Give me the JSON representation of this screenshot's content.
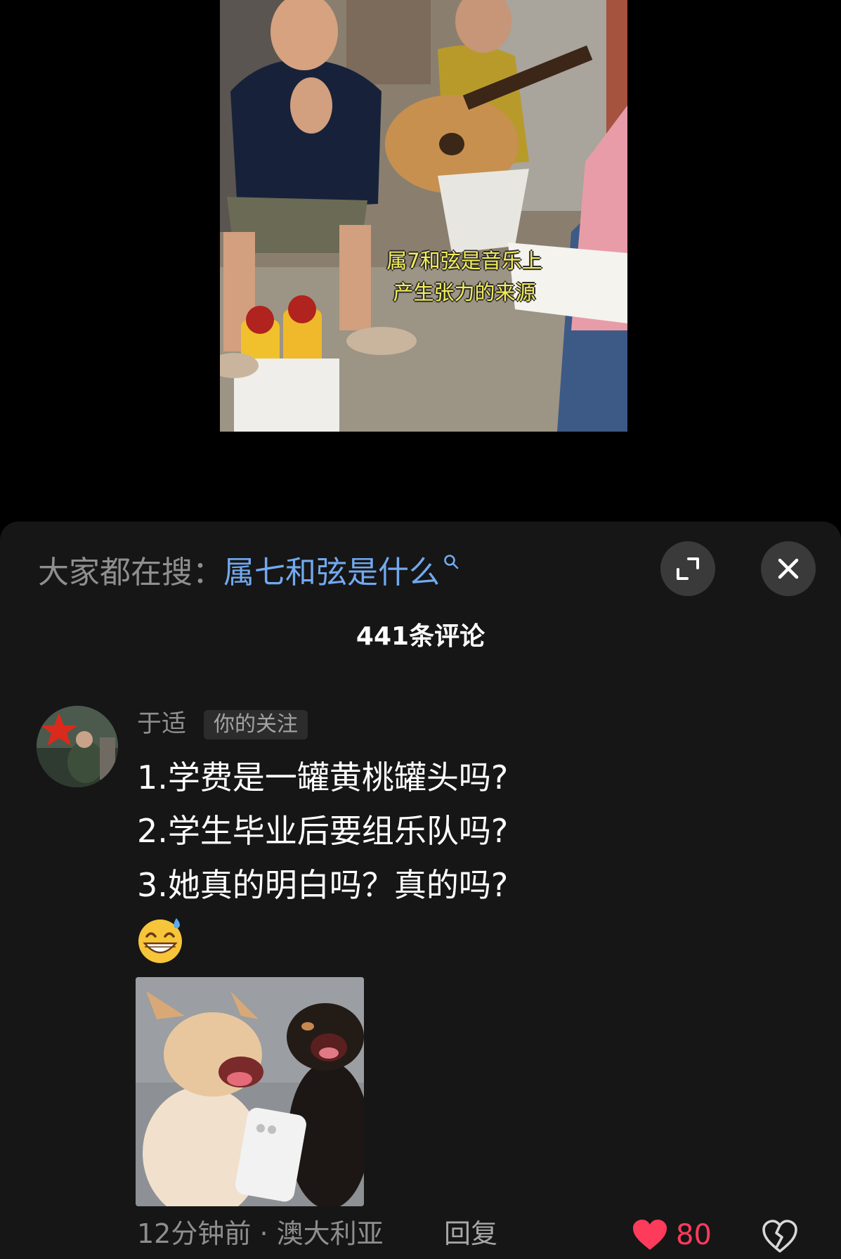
{
  "video": {
    "subtitle_line1": "属7和弦是音乐上",
    "subtitle_line2": "产生张力的来源"
  },
  "comments_panel": {
    "search_hint_prefix": "大家都在搜：",
    "search_hint_query": "属七和弦是什么",
    "expand_icon": "expand-icon",
    "close_icon": "close-icon",
    "comment_count": "441条评论"
  },
  "comment": {
    "username": "于适",
    "badge": "你的关注",
    "lines": [
      "1.学费是一罐黄桃罐头吗?",
      "2.学生毕业后要组乐队吗?",
      "3.她真的明白吗？真的吗?"
    ],
    "emoji_icon": "sweat-grin-emoji",
    "time": "12分钟前",
    "separator": "·",
    "location": "澳大利亚",
    "reply_label": "回复",
    "likes": "80",
    "like_icon": "heart-icon",
    "dislike_icon": "broken-heart-icon",
    "like_color": "#ff3b5c"
  },
  "colors": {
    "background": "#000000",
    "sheet": "#161616",
    "query_link": "#72a9f0",
    "subtitle": "#f3ec59"
  }
}
